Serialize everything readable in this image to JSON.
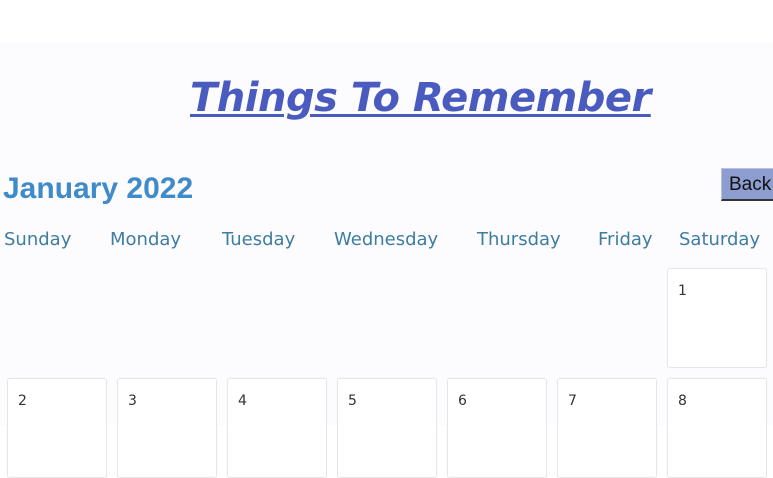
{
  "header": {
    "title": "Things To Remember"
  },
  "calendar": {
    "month_label": "January 2022",
    "back_label": "Back",
    "weekdays": [
      "Sunday",
      "Monday",
      "Tuesday",
      "Wednesday",
      "Thursday",
      "Friday",
      "Saturday"
    ],
    "days": [
      "1",
      "2",
      "3",
      "4",
      "5",
      "6",
      "7",
      "8"
    ]
  }
}
